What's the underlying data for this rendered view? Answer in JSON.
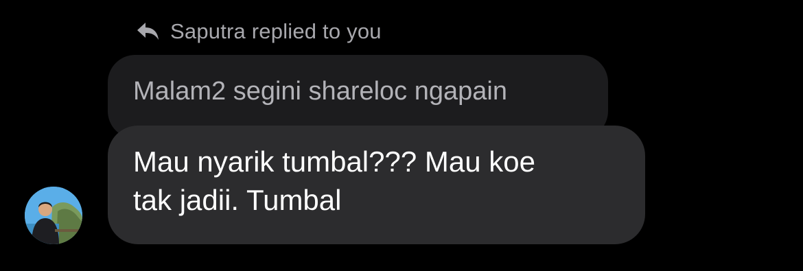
{
  "reply_header": {
    "icon": "reply-arrow-icon",
    "text": "Saputra replied to you"
  },
  "quoted_message": {
    "text": "Malam2 segini shareloc ngapain"
  },
  "message": {
    "text": "Mau nyarik tumbal??? Mau koe\ntak jadii. Tumbal"
  },
  "avatar": {
    "icon": "avatar-photo"
  },
  "colors": {
    "background": "#000000",
    "quoted_bubble": "#1c1c1e",
    "message_bubble": "#2c2c2e",
    "secondary_text": "#a8a8ad",
    "primary_text": "#ffffff"
  }
}
